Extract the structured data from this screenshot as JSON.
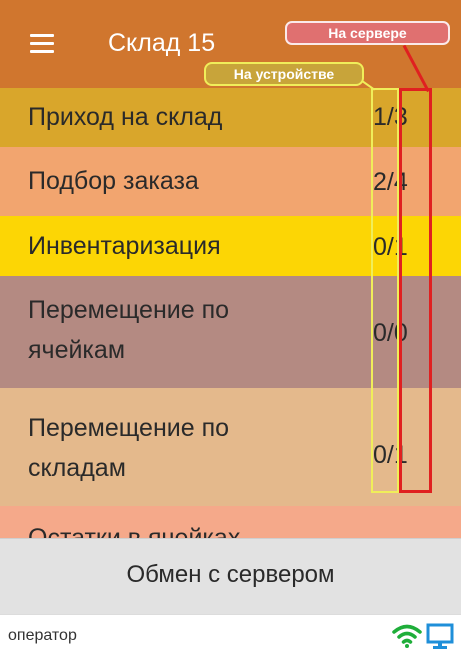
{
  "header": {
    "title": "Склад 15",
    "menu_icon": "hamburger-menu-icon",
    "background": "#d0762e"
  },
  "annotations": {
    "device_label": "На устройстве",
    "server_label": "На сервере",
    "device_color": "#f0ee5a",
    "server_color": "#e02020"
  },
  "menu": {
    "items": [
      {
        "label": "Приход на склад",
        "local": "1",
        "server": "3",
        "color": "#d9a62b"
      },
      {
        "label": "Подбор заказа",
        "local": "2",
        "server": "4",
        "color": "#f2a56f"
      },
      {
        "label": "Инвентаризация",
        "local": "0",
        "server": "1",
        "color": "#fcd605"
      },
      {
        "label": "Перемещение по\nячейкам",
        "local": "0",
        "server": "0",
        "color": "#b48a82"
      },
      {
        "label": "Перемещение по\nскладам",
        "local": "0",
        "server": "1",
        "color": "#e4b98c"
      },
      {
        "label": "Остатки в ячейках",
        "local": "",
        "server": "",
        "color": "#f5a98a"
      }
    ],
    "separator": "/"
  },
  "exchange": {
    "label": "Обмен с сервером"
  },
  "status_bar": {
    "operator": "оператор",
    "wifi_icon": "wifi-icon",
    "monitor_icon": "monitor-icon",
    "icon_color": "#1fae3a",
    "monitor_color": "#1f8fd9"
  }
}
